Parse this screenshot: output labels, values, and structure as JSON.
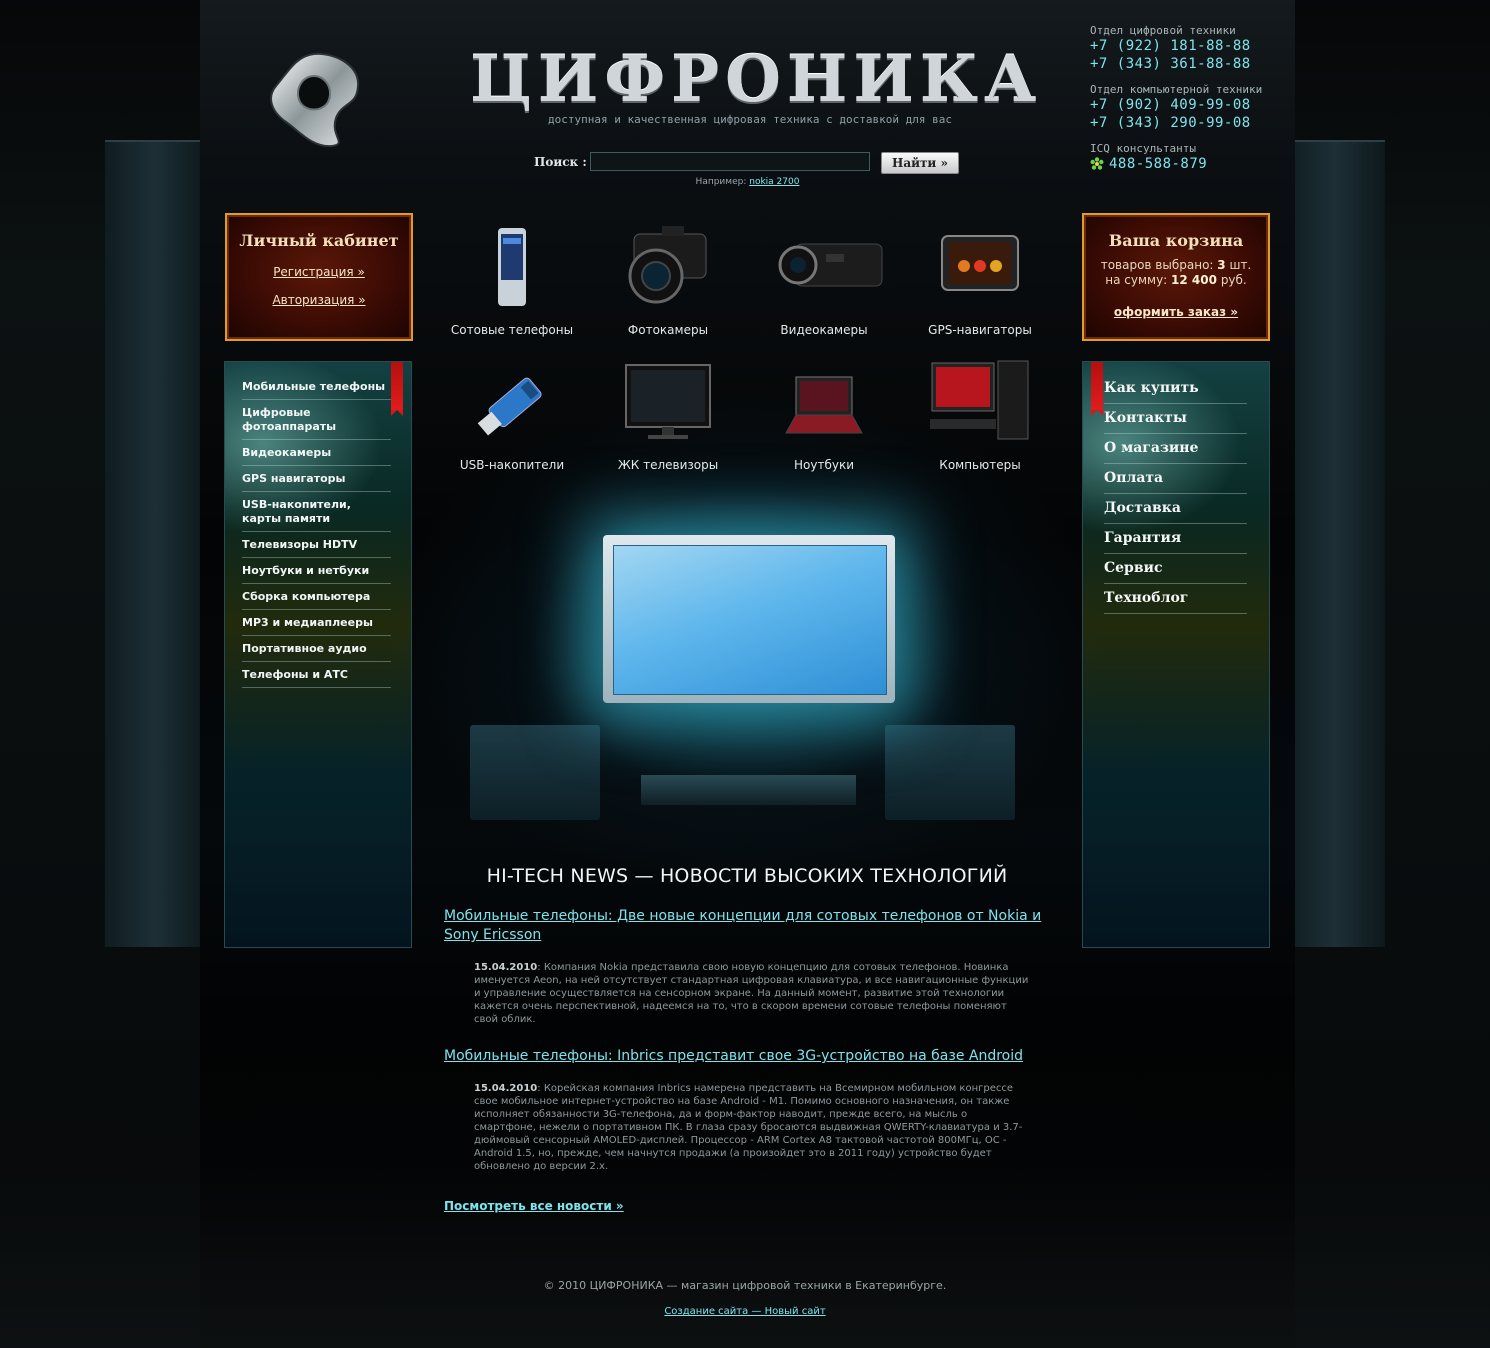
{
  "header": {
    "brand": "ЦИФРОНИКА",
    "tagline": "доступная и качественная цифровая техника с доставкой для вас",
    "search": {
      "label": "Поиск :",
      "value": "",
      "button": "Найти »",
      "hint_prefix": "Например:",
      "hint_link": "nokia 2700"
    },
    "contacts": {
      "digital_label": "Отдел цифровой техники",
      "digital_phone_1": "+7 (922) 181-88-88",
      "digital_phone_2": "+7 (343) 361-88-88",
      "computer_label": "Отдел компьютерной техники",
      "computer_phone_1": "+7 (902) 409-99-08",
      "computer_phone_2": "+7 (343) 290-99-08",
      "icq_label": "ICQ консультанты",
      "icq_number": "488-588-879"
    }
  },
  "account": {
    "title": "Личный кабинет",
    "register": "Регистрация »",
    "login": "Авторизация »"
  },
  "cart": {
    "title": "Ваша корзина",
    "items_prefix": "товаров выбрано:",
    "items_count": "3",
    "items_suffix": "шт.",
    "sum_prefix": "на сумму:",
    "sum_value": "12 400",
    "sum_suffix": "руб.",
    "order": "оформить заказ »"
  },
  "left_menu": [
    "Мобильные телефоны",
    "Цифровые фотоаппараты",
    "Видеокамеры",
    "GPS навигаторы",
    "USB-накопители, карты памяти",
    "Телевизоры HDTV",
    "Ноутбуки и нетбуки",
    "Сборка компьютера",
    "MP3 и медиаплееры",
    "Портативное аудио",
    "Телефоны и АТС"
  ],
  "right_menu": [
    "Как купить",
    "Контакты",
    "О магазине",
    "Оплата",
    "Доставка",
    "Гарантия",
    "Сервис",
    "Техноблог"
  ],
  "categories": [
    {
      "label": "Сотовые телефоны",
      "icon": "cell-phone-icon"
    },
    {
      "label": "Фотокамеры",
      "icon": "camera-icon"
    },
    {
      "label": "Видеокамеры",
      "icon": "camcorder-icon"
    },
    {
      "label": "GPS-навигаторы",
      "icon": "gps-navigator-icon"
    },
    {
      "label": "USB-накопители",
      "icon": "usb-drive-icon"
    },
    {
      "label": "ЖК телевизоры",
      "icon": "lcd-tv-icon"
    },
    {
      "label": "Ноутбуки",
      "icon": "laptop-icon"
    },
    {
      "label": "Компьютеры",
      "icon": "desktop-computer-icon"
    }
  ],
  "news": {
    "heading": "HI-TECH NEWS — НОВОСТИ ВЫСОКИХ ТЕХНОЛОГИЙ",
    "items": [
      {
        "title": "Мобильные телефоны: Две новые концепции для сотовых телефонов от Nokia и Sony Ericsson",
        "date": "15.04.2010",
        "text": ": Компания Nokia представила свою новую концепцию для сотовых телефонов. Новинка именуется Aeon, на ней отсутствует стандартная цифровая клавиатура, и все навигационные функции и управление осуществляется на сенсорном экране. На данный момент, развитие этой технологии кажется очень перспективной, надеемся на то, что в скором времени сотовые телефоны поменяют свой облик."
      },
      {
        "title": "Мобильные телефоны: Inbrics представит свое 3G-устройство на базе Android",
        "date": "15.04.2010",
        "text": ": Корейская компания Inbrics намерена представить на Всемирном мобильном конгрессе свое мобильное интернет-устройство на базе Android - M1. Помимо основного назначения, он также исполняет обязанности 3G-телефона, да и форм-фактор наводит, прежде всего, на мысль о смартфоне, нежели о портативном ПК. В глаза сразу бросаются выдвижная QWERTY-клавиатура и 3.7-дюймовый сенсорный AMOLED-дисплей. Процессор - ARM Cortex A8 тактовой частотой 800МГц, ОС - Android 1.5, но, прежде, чем начнутся продажи (а произойдет это в 2011 году) устройство будет обновлено до версии 2.x."
      }
    ],
    "all_link": "Посмотреть все новости »"
  },
  "footer": {
    "copyright": "© 2010 ЦИФРОНИКА — магазин цифровой техники в Екатеринбурге.",
    "credit": "Создание сайта — Новый сайт"
  },
  "colors": {
    "accent_link": "#7fe3ec",
    "box_border": "#e29b2b",
    "ribbon": "#d61818"
  }
}
